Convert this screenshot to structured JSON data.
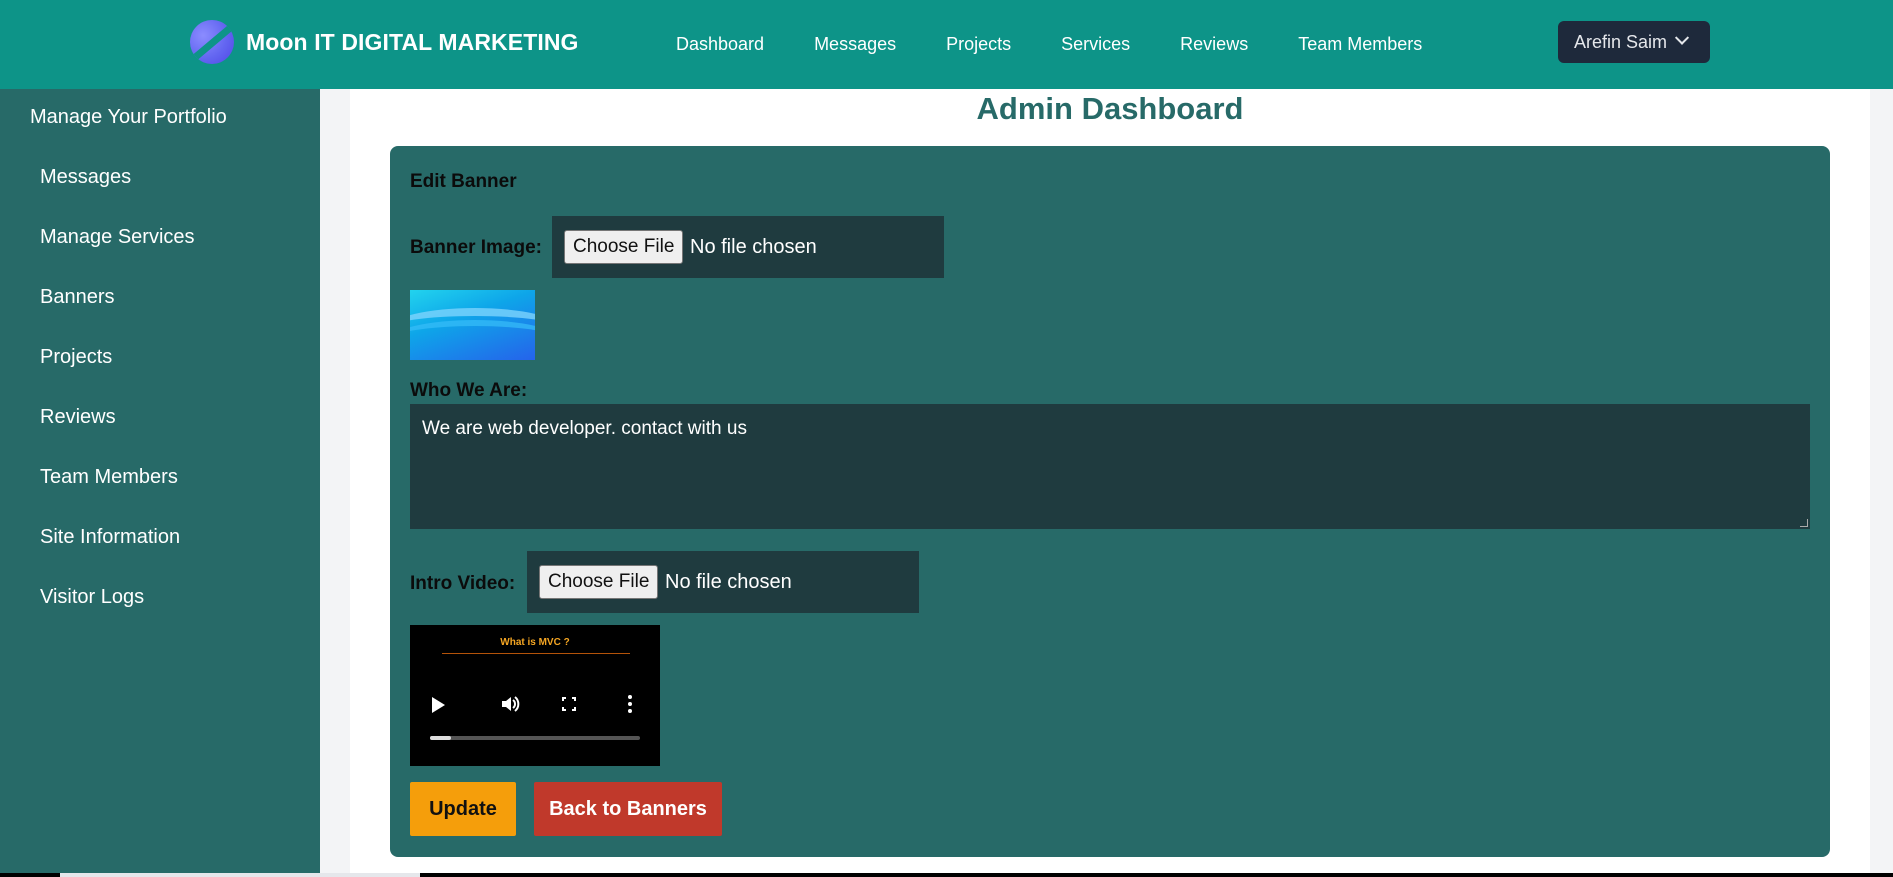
{
  "header": {
    "brand": "Moon IT DIGITAL MARKETING",
    "nav": [
      "Dashboard",
      "Messages",
      "Projects",
      "Services",
      "Reviews",
      "Team Members"
    ],
    "user": "Arefin Saim",
    "brand_color": "#0d9488"
  },
  "sidebar": {
    "title": "Manage Your Portfolio",
    "items": [
      "Messages",
      "Manage Services",
      "Banners",
      "Projects",
      "Reviews",
      "Team Members",
      "Site Information",
      "Visitor Logs"
    ]
  },
  "main": {
    "page_title": "Admin Dashboard",
    "form": {
      "heading": "Edit Banner",
      "banner_image_label": "Banner Image:",
      "choose_file": "Choose File",
      "no_file": "No file chosen",
      "who_label": "Who We Are:",
      "who_value": "We are web developer. contact with us",
      "video_label": "Intro Video:",
      "video_title": "What is MVC ?",
      "video_progress": 0.1,
      "update": "Update",
      "back": "Back to Banners"
    }
  }
}
